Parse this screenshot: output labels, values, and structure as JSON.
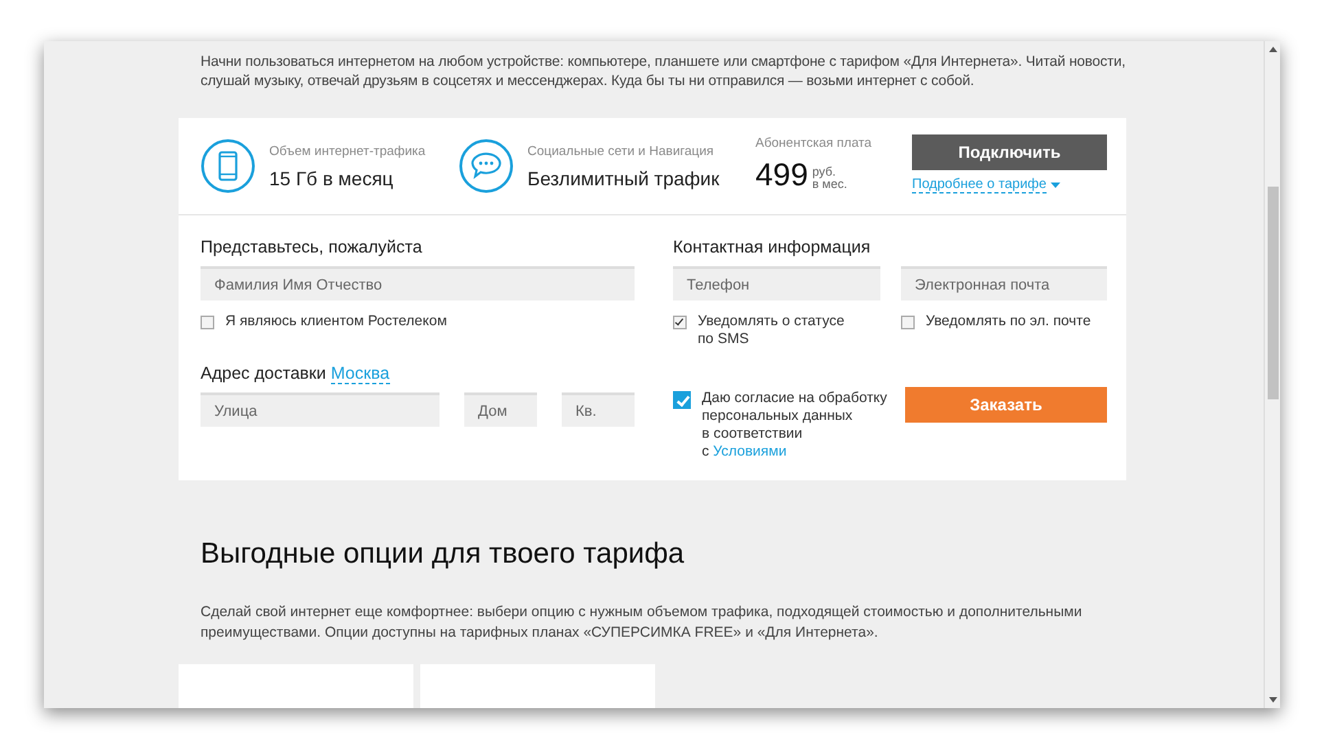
{
  "intro": "Начни пользоваться интернетом на любом устройстве: компьютере, планшете или смартфоне с тарифом «Для Интернета». Читай новости, слушай музыку, отвечай друзьям в соцсетях и мессенджерах. Куда бы ты ни отправился — возьми интернет с собой.",
  "tariff": {
    "features": [
      {
        "kind": "phone",
        "caption": "Объем интернет-трафика",
        "value": "15 Гб в месяц"
      },
      {
        "kind": "chat",
        "caption": "Социальные сети и Навигация",
        "value": "Безлимитный трафик"
      }
    ],
    "price": {
      "caption": "Абонентская плата",
      "amount": "499",
      "currency": "руб.",
      "period": "в мес."
    },
    "connect_button": "Подключить",
    "details_link": "Подробнее о тарифе"
  },
  "form": {
    "personal": {
      "heading": "Представьтесь, пожалуйста",
      "name_field": {
        "placeholder": "Фамилия Имя Отчество"
      },
      "client_checkbox": {
        "label": "Я являюсь клиентом Ростелеком",
        "checked": false
      }
    },
    "contact": {
      "heading": "Контактная информация",
      "phone_field": {
        "placeholder": "Телефон"
      },
      "email_field": {
        "placeholder": "Электронная почта"
      },
      "sms_checkbox": {
        "label": "Уведомлять о статусе по SMS",
        "checked": true
      },
      "email_checkbox": {
        "label": "Уведомлять по эл. почте",
        "checked": false
      }
    },
    "delivery": {
      "heading": "Адрес доставки",
      "city": "Москва",
      "fields": [
        {
          "placeholder": "Улица"
        },
        {
          "placeholder": "Дом"
        },
        {
          "placeholder": "Кв."
        }
      ]
    },
    "consent": {
      "lines": [
        "Даю согласие на обработку",
        "персональных данных",
        "в соответствии"
      ],
      "link_prefix": "с",
      "link": "Условиями",
      "checked": true
    },
    "order_button": "Заказать"
  },
  "options": {
    "title": "Выгодные опции для твоего тарифа",
    "description": "Сделай свой интернет еще комфортнее: выбери опцию с нужным объемом трафика, подходящей стоимостью и дополнительными преимуществами. Опции доступны на тарифных планах «СУПЕРСИМКА FREE» и «Для Интернета»."
  }
}
